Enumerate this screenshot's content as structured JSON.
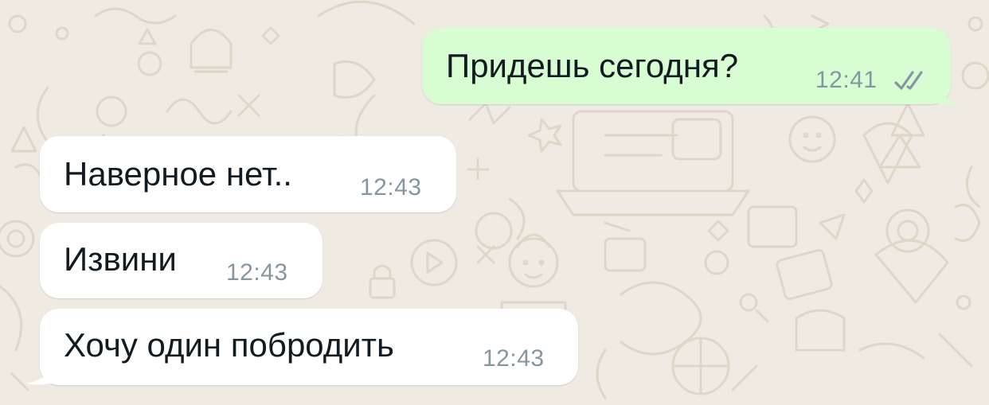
{
  "colors": {
    "background": "#efeae2",
    "outgoing_bubble": "#d9fdd3",
    "incoming_bubble": "#ffffff",
    "text": "#111b21",
    "timestamp": "#8696a0",
    "read_ticks": "#8696a0",
    "doodle": "#e2d9cc"
  },
  "messages": [
    {
      "direction": "outgoing",
      "text": "Придешь сегодня?",
      "time": "12:41",
      "status": "double-check-icon"
    },
    {
      "direction": "incoming",
      "text": "Наверное нет..",
      "time": "12:43"
    },
    {
      "direction": "incoming",
      "text": "Извини",
      "time": "12:43"
    },
    {
      "direction": "incoming",
      "text": "Хочу один побродить",
      "time": "12:43"
    }
  ]
}
